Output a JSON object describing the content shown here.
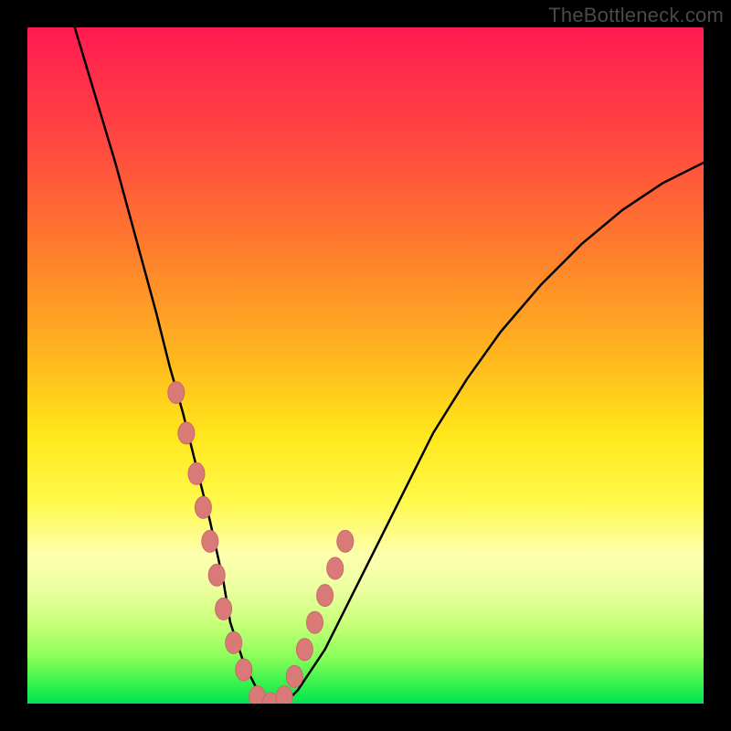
{
  "watermark": {
    "text": "TheBottleneck.com"
  },
  "colors": {
    "frame": "#000000",
    "curve": "#000000",
    "marker_fill": "#d97a78",
    "marker_stroke": "#c96a68",
    "gradient_top": "#ff1a52",
    "gradient_bottom": "#00e452"
  },
  "chart_data": {
    "type": "line",
    "title": "",
    "xlabel": "",
    "ylabel": "",
    "xlim": [
      0,
      100
    ],
    "ylim": [
      0,
      100
    ],
    "grid": false,
    "legend": false,
    "series": [
      {
        "name": "bottleneck-curve",
        "x": [
          7,
          10,
          13,
          16,
          19,
          21,
          23,
          25,
          27,
          29,
          30,
          32,
          34,
          36,
          38,
          40,
          44,
          48,
          52,
          56,
          60,
          65,
          70,
          76,
          82,
          88,
          94,
          100
        ],
        "y": [
          100,
          90,
          80,
          69,
          58,
          50,
          43,
          35,
          27,
          18,
          12,
          6,
          2,
          0,
          0,
          2,
          8,
          16,
          24,
          32,
          40,
          48,
          55,
          62,
          68,
          73,
          77,
          80
        ]
      }
    ],
    "markers": {
      "name": "highlight-dots",
      "x": [
        22,
        23.5,
        25,
        26,
        27,
        28,
        29,
        30.5,
        32,
        34,
        36,
        38,
        39.5,
        41,
        42.5,
        44,
        45.5,
        47
      ],
      "y": [
        46,
        40,
        34,
        29,
        24,
        19,
        14,
        9,
        5,
        1,
        0,
        1,
        4,
        8,
        12,
        16,
        20,
        24
      ]
    }
  }
}
